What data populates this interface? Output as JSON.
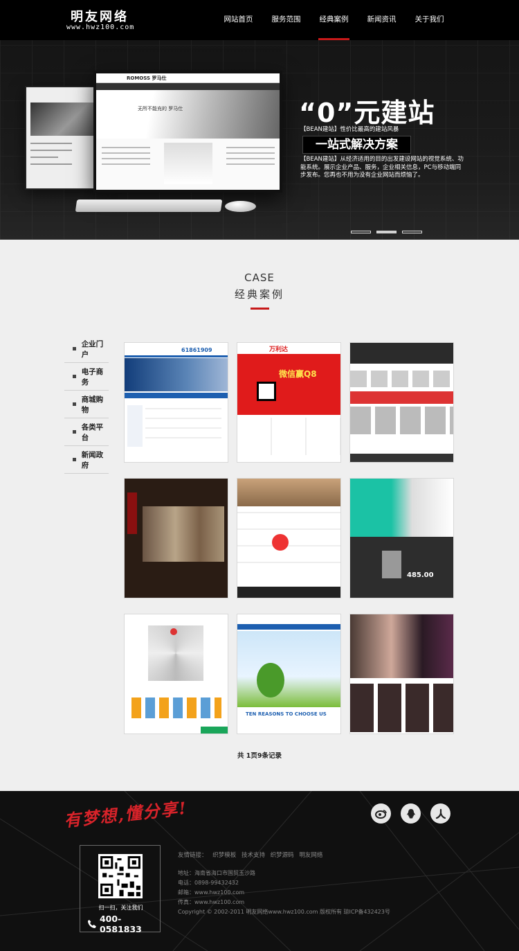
{
  "header": {
    "logo_cn": "明友网络",
    "logo_en": "www.hwz100.com",
    "nav": [
      {
        "label": "网站首页"
      },
      {
        "label": "服务范围"
      },
      {
        "label": "经典案例",
        "active": true
      },
      {
        "label": "新闻资讯"
      },
      {
        "label": "关于我们"
      }
    ]
  },
  "banner": {
    "headline": "“0”元建站",
    "line1": "【BEAN建站】性价比最高的建站风暴",
    "box": "一站式解决方案",
    "desc": "【BEAN建站】从经济适用的目的出发建设网站的视觉系统、功能系统。展示企业产品、服务，企业相关信息，PC与移动端同步发布。您再也不用为没有企业网站而烦恼了。",
    "mock_brand": "ROMOSS 罗马仕",
    "mock_hero": "无所不能充的 罗马仕",
    "slides": 3,
    "active_slide": 1
  },
  "case": {
    "title_en": "CASE",
    "title_cn": "经典案例"
  },
  "side_menu": [
    {
      "label": "企业门户"
    },
    {
      "label": "电子商务"
    },
    {
      "label": "商城购物"
    },
    {
      "label": "各类平台"
    },
    {
      "label": "新闻政府"
    }
  ],
  "tiles": [
    {
      "label": "61861909"
    },
    {
      "label": "万利达",
      "sub": "微信赢Q8"
    },
    {
      "label": ""
    },
    {
      "label": ""
    },
    {
      "label": ""
    },
    {
      "label": "485.00"
    },
    {
      "label": ""
    },
    {
      "label": "TEN REASONS TO CHOOSE US"
    },
    {
      "label": ""
    }
  ],
  "pager": "共 1页9条记录",
  "footer": {
    "slogan": "有梦想,懂分享!",
    "social": [
      "weibo-icon",
      "qq-icon",
      "renren-icon"
    ],
    "qr_caption": "扫一扫，关注我们",
    "phone": "400-0581833",
    "links_label": "友情链接：",
    "links": [
      "织梦模板",
      "技术支持",
      "织梦源码",
      "明友网络"
    ],
    "address": "地址：海南省海口市国贸玉沙路",
    "tel": "电话：0898-99432432",
    "email": "邮箱：www.hwz100.com",
    "fax": "传真：www.hwz100.com",
    "copyright": "Copyright © 2002-2011 明友网络www.hwz100.com 版权所有  琼ICP备432423号"
  },
  "colors": {
    "accent": "#c71919",
    "header": "#000000",
    "footer": "#101010"
  }
}
